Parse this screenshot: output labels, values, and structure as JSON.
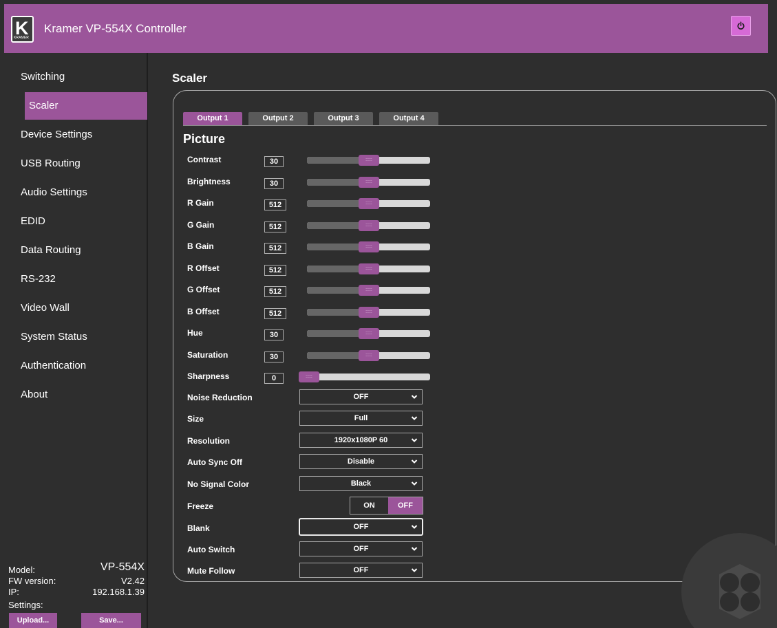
{
  "header": {
    "logo_letter": "K",
    "logo_text": "KRAMER",
    "title": "Kramer VP-554X Controller"
  },
  "sidebar": {
    "items": [
      {
        "label": "Switching"
      },
      {
        "label": "Scaler"
      },
      {
        "label": "Device Settings"
      },
      {
        "label": "USB Routing"
      },
      {
        "label": "Audio Settings"
      },
      {
        "label": "EDID"
      },
      {
        "label": "Data Routing"
      },
      {
        "label": "RS-232"
      },
      {
        "label": "Video Wall"
      },
      {
        "label": "System Status"
      },
      {
        "label": "Authentication"
      },
      {
        "label": "About"
      }
    ],
    "active_index": 1,
    "info": {
      "model_label": "Model:",
      "model_value": "VP-554X",
      "fw_label": "FW version:",
      "fw_value": "V2.42",
      "ip_label": "IP:",
      "ip_value": "192.168.1.39",
      "settings_label": "Settings:"
    },
    "upload_label": "Upload...",
    "save_label": "Save..."
  },
  "main": {
    "page_title": "Scaler",
    "tabs": [
      {
        "label": "Output 1"
      },
      {
        "label": "Output 2"
      },
      {
        "label": "Output 3"
      },
      {
        "label": "Output 4"
      }
    ],
    "active_tab": 0,
    "section_title": "Picture",
    "sliders": [
      {
        "label": "Contrast",
        "value": "30",
        "level": 0.5
      },
      {
        "label": "Brightness",
        "value": "30",
        "level": 0.5
      },
      {
        "label": "R Gain",
        "value": "512",
        "level": 0.5
      },
      {
        "label": "G Gain",
        "value": "512",
        "level": 0.5
      },
      {
        "label": "B Gain",
        "value": "512",
        "level": 0.5
      },
      {
        "label": "R Offset",
        "value": "512",
        "level": 0.5
      },
      {
        "label": "G Offset",
        "value": "512",
        "level": 0.5
      },
      {
        "label": "B Offset",
        "value": "512",
        "level": 0.5
      },
      {
        "label": "Hue",
        "value": "30",
        "level": 0.5
      },
      {
        "label": "Saturation",
        "value": "30",
        "level": 0.5
      },
      {
        "label": "Sharpness",
        "value": "0",
        "level": 0.0
      }
    ],
    "thumb_grip": ":::::",
    "selects": {
      "noise_reduction": {
        "label": "Noise Reduction",
        "value": "OFF"
      },
      "size": {
        "label": "Size",
        "value": "Full"
      },
      "resolution": {
        "label": "Resolution",
        "value": "1920x1080P 60"
      },
      "auto_sync_off": {
        "label": "Auto Sync Off",
        "value": "Disable"
      },
      "no_signal_color": {
        "label": "No Signal Color",
        "value": "Black"
      },
      "blank": {
        "label": "Blank",
        "value": "OFF"
      },
      "auto_switch": {
        "label": "Auto Switch",
        "value": "OFF"
      },
      "mute_follow": {
        "label": "Mute Follow",
        "value": "OFF"
      }
    },
    "freeze": {
      "label": "Freeze",
      "on_label": "ON",
      "off_label": "OFF",
      "state": "OFF"
    }
  },
  "colors": {
    "accent": "#9b559a",
    "power_button": "#d66ad6",
    "background": "#2e2e2e",
    "slider_track": "#d8d8d8",
    "slider_fill": "#666666"
  },
  "icons": {
    "power": "power-icon",
    "chevron": "chevron-down-icon",
    "watermark": "gamepad-watermark-icon"
  }
}
